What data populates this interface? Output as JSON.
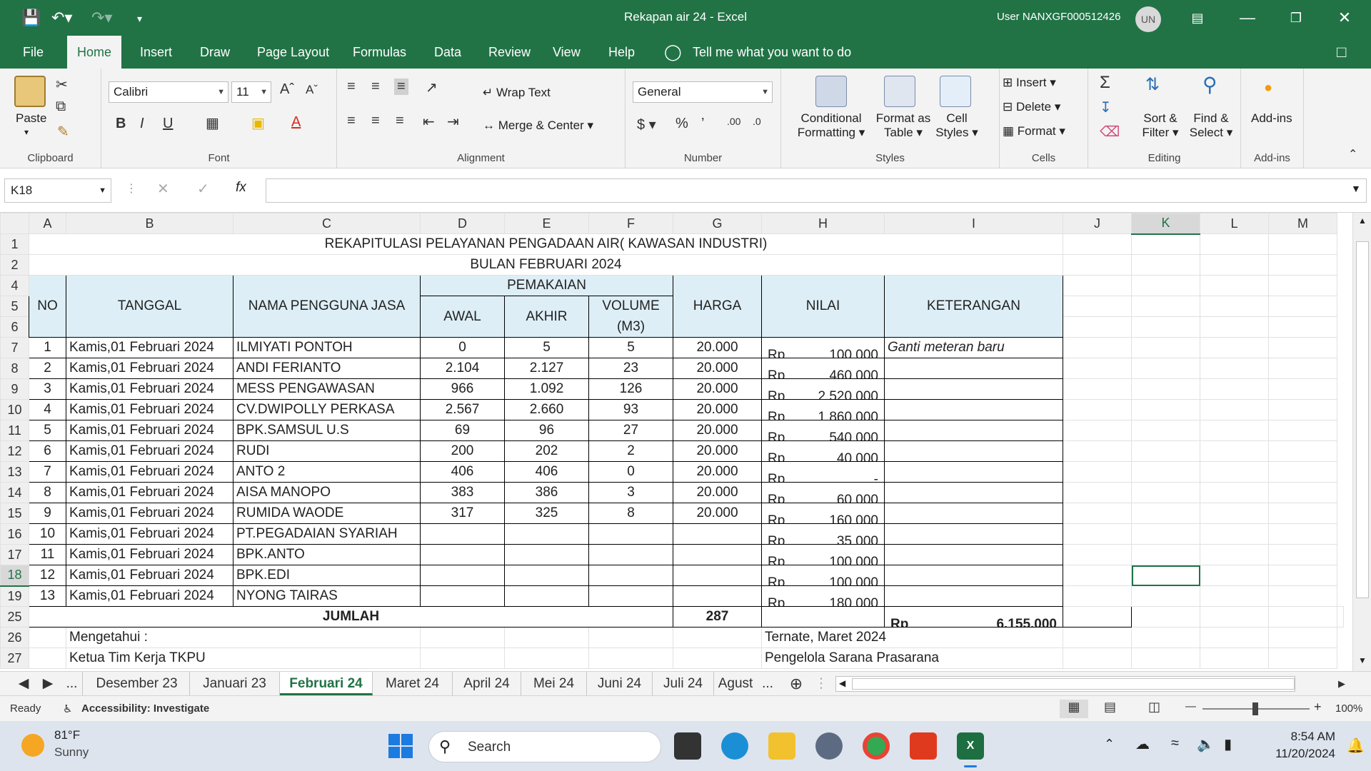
{
  "titlebar": {
    "doc_title": "Rekapan air 24  -  Excel",
    "user": "User NANXGF000512426",
    "avatar": "UN"
  },
  "menu": {
    "tabs": [
      "File",
      "Home",
      "Insert",
      "Draw",
      "Page Layout",
      "Formulas",
      "Data",
      "Review",
      "View",
      "Help"
    ],
    "active": "Home",
    "tell_me": "Tell me what you want to do"
  },
  "ribbon": {
    "clipboard": {
      "paste": "Paste",
      "label": "Clipboard"
    },
    "font": {
      "name": "Calibri",
      "size": "11",
      "label": "Font"
    },
    "alignment": {
      "wrap": "Wrap Text",
      "merge": "Merge & Center",
      "label": "Alignment"
    },
    "number": {
      "format": "General",
      "label": "Number"
    },
    "styles": {
      "conditional_1": "Conditional",
      "conditional_2": "Formatting",
      "format_as_1": "Format as",
      "format_as_2": "Table",
      "cell_1": "Cell",
      "cell_2": "Styles",
      "label": "Styles"
    },
    "cells": {
      "insert": "Insert",
      "delete": "Delete",
      "format": "Format",
      "label": "Cells"
    },
    "editing": {
      "sort_1": "Sort &",
      "sort_2": "Filter",
      "find_1": "Find &",
      "find_2": "Select",
      "label": "Editing"
    },
    "addins": {
      "btn": "Add-ins",
      "label": "Add-ins"
    }
  },
  "formula_bar": {
    "name_box": "K18",
    "fx": "fx",
    "content": ""
  },
  "columns": [
    "A",
    "B",
    "C",
    "D",
    "E",
    "F",
    "G",
    "H",
    "I",
    "J",
    "K",
    "L",
    "M"
  ],
  "sheet": {
    "title1": "REKAPITULASI PELAYANAN PENGADAAN AIR( KAWASAN INDUSTRI)",
    "title2": "BULAN FEBRUARI 2024",
    "headers": {
      "no": "NO",
      "tanggal": "TANGGAL",
      "nama": "NAMA PENGGUNA JASA",
      "pemakaian": "PEMAKAIAN",
      "awal": "AWAL",
      "akhir": "AKHIR",
      "volume": "VOLUME",
      "volume_unit": "(M3)",
      "harga": "HARGA",
      "nilai": "NILAI",
      "keterangan": "KETERANGAN"
    },
    "rows": [
      {
        "row": "7",
        "no": "1",
        "tanggal": "Kamis,01 Februari 2024",
        "nama": "ILMIYATI PONTOH",
        "awal": "0",
        "akhir": "5",
        "volume": "5",
        "harga": "20.000",
        "rp": "Rp",
        "nilai": "100.000",
        "ket": "Ganti meteran baru"
      },
      {
        "row": "8",
        "no": "2",
        "tanggal": "Kamis,01 Februari 2024",
        "nama": "ANDI FERIANTO",
        "awal": "2.104",
        "akhir": "2.127",
        "volume": "23",
        "harga": "20.000",
        "rp": "Rp",
        "nilai": "460.000",
        "ket": ""
      },
      {
        "row": "9",
        "no": "3",
        "tanggal": "Kamis,01 Februari 2024",
        "nama": "MESS PENGAWASAN",
        "awal": "966",
        "akhir": "1.092",
        "volume": "126",
        "harga": "20.000",
        "rp": "Rp",
        "nilai": "2.520.000",
        "ket": ""
      },
      {
        "row": "10",
        "no": "4",
        "tanggal": "Kamis,01 Februari 2024",
        "nama": "CV.DWIPOLLY PERKASA",
        "awal": "2.567",
        "akhir": "2.660",
        "volume": "93",
        "harga": "20.000",
        "rp": "Rp",
        "nilai": "1.860.000",
        "ket": ""
      },
      {
        "row": "11",
        "no": "5",
        "tanggal": "Kamis,01 Februari 2024",
        "nama": "BPK.SAMSUL U.S",
        "awal": "69",
        "akhir": "96",
        "volume": "27",
        "harga": "20.000",
        "rp": "Rp",
        "nilai": "540.000",
        "ket": ""
      },
      {
        "row": "12",
        "no": "6",
        "tanggal": "Kamis,01 Februari 2024",
        "nama": "RUDI",
        "awal": "200",
        "akhir": "202",
        "volume": "2",
        "harga": "20.000",
        "rp": "Rp",
        "nilai": "40.000",
        "ket": ""
      },
      {
        "row": "13",
        "no": "7",
        "tanggal": "Kamis,01 Februari 2024",
        "nama": "ANTO 2",
        "awal": "406",
        "akhir": "406",
        "volume": "0",
        "harga": "20.000",
        "rp": "Rp",
        "nilai": "-",
        "ket": ""
      },
      {
        "row": "14",
        "no": "8",
        "tanggal": "Kamis,01 Februari 2024",
        "nama": "AISA MANOPO",
        "awal": "383",
        "akhir": "386",
        "volume": "3",
        "harga": "20.000",
        "rp": "Rp",
        "nilai": "60.000",
        "ket": ""
      },
      {
        "row": "15",
        "no": "9",
        "tanggal": "Kamis,01 Februari 2024",
        "nama": "RUMIDA WAODE",
        "awal": "317",
        "akhir": "325",
        "volume": "8",
        "harga": "20.000",
        "rp": "Rp",
        "nilai": "160.000",
        "ket": ""
      },
      {
        "row": "16",
        "no": "10",
        "tanggal": "Kamis,01 Februari 2024",
        "nama": "PT.PEGADAIAN SYARIAH",
        "awal": "",
        "akhir": "",
        "volume": "",
        "harga": "",
        "rp": "Rp",
        "nilai": "35.000",
        "ket": ""
      },
      {
        "row": "17",
        "no": "11",
        "tanggal": "Kamis,01 Februari 2024",
        "nama": "BPK.ANTO",
        "awal": "",
        "akhir": "",
        "volume": "",
        "harga": "",
        "rp": "Rp",
        "nilai": "100.000",
        "ket": ""
      },
      {
        "row": "18",
        "no": "12",
        "tanggal": "Kamis,01 Februari 2024",
        "nama": "BPK.EDI",
        "awal": "",
        "akhir": "",
        "volume": "",
        "harga": "",
        "rp": "Rp",
        "nilai": "100.000",
        "ket": ""
      },
      {
        "row": "19",
        "no": "13",
        "tanggal": "Kamis,01 Februari 2024",
        "nama": "NYONG TAIRAS",
        "awal": "",
        "akhir": "",
        "volume": "",
        "harga": "",
        "rp": "Rp",
        "nilai": "180.000",
        "ket": ""
      }
    ],
    "jumlah": {
      "label": "JUMLAH",
      "volume": "287",
      "rp": "Rp",
      "nilai": "6.155.000"
    },
    "footer": {
      "mengetahui": "Mengetahui :",
      "ketua": "Ketua Tim Kerja TKPU",
      "ternate": "Ternate,     Maret 2024",
      "pengelola": "Pengelola Sarana Prasarana"
    }
  },
  "row_numbers": [
    "1",
    "2",
    "4",
    "5",
    "6",
    "7",
    "8",
    "9",
    "10",
    "11",
    "12",
    "13",
    "14",
    "15",
    "16",
    "17",
    "18",
    "19",
    "25",
    "26",
    "27"
  ],
  "sheet_tabs": [
    "Desember 23",
    "Januari 23",
    "Februari 24",
    "Maret 24",
    "April 24",
    "Mei 24",
    "Juni 24",
    "Juli 24",
    "Agust"
  ],
  "active_sheet": "Februari 24",
  "status": {
    "ready": "Ready",
    "accessibility": "Accessibility: Investigate",
    "zoom": "100%"
  },
  "taskbar": {
    "temp": "81°F",
    "weather": "Sunny",
    "search": "Search",
    "time": "8:54 AM",
    "date": "11/20/2024"
  },
  "colors": {
    "excel_green": "#217346",
    "header_fill": "#ddeef6"
  }
}
